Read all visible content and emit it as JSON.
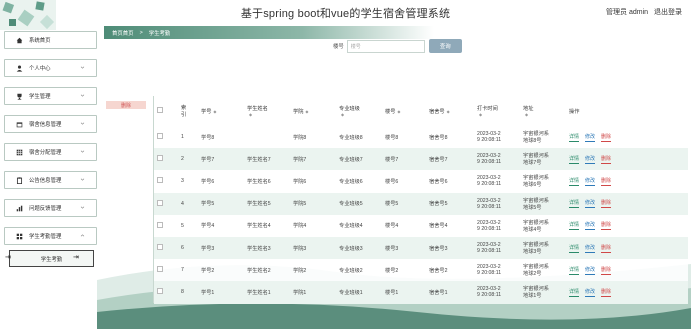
{
  "header": {
    "title": "基于spring boot和vue的学生宿舍管理系统",
    "user_label": "管理员 admin",
    "logout": "退出登录"
  },
  "sidebar": {
    "items": [
      {
        "label": "系统首页",
        "icon": "home-icon",
        "has_chevron": false
      },
      {
        "label": "个人中心",
        "icon": "user-icon",
        "has_chevron": true
      },
      {
        "label": "学生管理",
        "icon": "trophy-icon",
        "has_chevron": true
      },
      {
        "label": "宿舍信息管理",
        "icon": "calendar-icon",
        "has_chevron": true
      },
      {
        "label": "宿舍分配管理",
        "icon": "grid-icon",
        "has_chevron": true
      },
      {
        "label": "公告信息管理",
        "icon": "clipboard-icon",
        "has_chevron": true
      },
      {
        "label": "问题反馈管理",
        "icon": "bar-chart-icon",
        "has_chevron": true
      },
      {
        "label": "学生考勤管理",
        "icon": "apps-icon",
        "has_chevron": true,
        "expanded": true
      }
    ],
    "submenu_label": "学生考勤"
  },
  "breadcrumb": {
    "home": "首页首页",
    "separator": ">",
    "current": "学生考勤"
  },
  "search": {
    "label": "楼号",
    "placeholder": "楼号",
    "button": "查询"
  },
  "toolbar": {
    "delete_label": "删除"
  },
  "table": {
    "columns": [
      "索引",
      "学号",
      "学生姓名",
      "学院",
      "专业班级",
      "楼号",
      "宿舍号",
      "打卡时间",
      "地址",
      "操作"
    ],
    "index_header_lines": [
      "索",
      "引"
    ],
    "time_header": "打卡时间",
    "actions": {
      "detail": "详情",
      "edit": "修改",
      "delete": "删除"
    },
    "rows": [
      {
        "index": "1",
        "xuehao": "学号8",
        "name": "",
        "college": "学院8",
        "major": "专业班级8",
        "building": "楼号8",
        "dorm": "宿舍号8",
        "time": [
          "2023-03-2",
          "9 20:08:11"
        ],
        "address": [
          "宇宙银河系",
          "地球8号"
        ]
      },
      {
        "index": "2",
        "xuehao": "学号7",
        "name": "学生姓名7",
        "college": "学院7",
        "major": "专业班级7",
        "building": "楼号7",
        "dorm": "宿舍号7",
        "time": [
          "2023-03-2",
          "9 20:08:11"
        ],
        "address": [
          "宇宙银河系",
          "地球7号"
        ]
      },
      {
        "index": "3",
        "xuehao": "学号6",
        "name": "学生姓名6",
        "college": "学院6",
        "major": "专业班级6",
        "building": "楼号6",
        "dorm": "宿舍号6",
        "time": [
          "2023-03-2",
          "9 20:08:11"
        ],
        "address": [
          "宇宙银河系",
          "地球6号"
        ]
      },
      {
        "index": "4",
        "xuehao": "学号5",
        "name": "学生姓名5",
        "college": "学院5",
        "major": "专业班级5",
        "building": "楼号5",
        "dorm": "宿舍号5",
        "time": [
          "2023-03-2",
          "9 20:08:11"
        ],
        "address": [
          "宇宙银河系",
          "地球5号"
        ]
      },
      {
        "index": "5",
        "xuehao": "学号4",
        "name": "学生姓名4",
        "college": "学院4",
        "major": "专业班级4",
        "building": "楼号4",
        "dorm": "宿舍号4",
        "time": [
          "2023-03-2",
          "9 20:08:11"
        ],
        "address": [
          "宇宙银河系",
          "地球4号"
        ]
      },
      {
        "index": "6",
        "xuehao": "学号3",
        "name": "学生姓名3",
        "college": "学院3",
        "major": "专业班级3",
        "building": "楼号3",
        "dorm": "宿舍号3",
        "time": [
          "2023-03-2",
          "9 20:08:11"
        ],
        "address": [
          "宇宙银河系",
          "地球3号"
        ]
      },
      {
        "index": "7",
        "xuehao": "学号2",
        "name": "学生姓名2",
        "college": "学院2",
        "major": "专业班级2",
        "building": "楼号2",
        "dorm": "宿舍号2",
        "time": [
          "2023-03-2",
          "9 20:08:11"
        ],
        "address": [
          "宇宙银河系",
          "地球2号"
        ]
      },
      {
        "index": "8",
        "xuehao": "学号1",
        "name": "学生姓名1",
        "college": "学院1",
        "major": "专业班级1",
        "building": "楼号1",
        "dorm": "宿舍号1",
        "time": [
          "2023-03-2",
          "9 20:08:11"
        ],
        "address": [
          "宇宙银河系",
          "地球1号"
        ]
      }
    ]
  },
  "colors": {
    "accent": "#4e8c77",
    "wave": "#5b8e7d",
    "search_button": "#8fa9b9",
    "delete_bg": "#f6d6d0"
  }
}
